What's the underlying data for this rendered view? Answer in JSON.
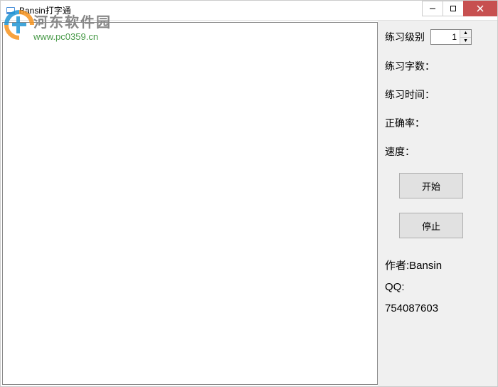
{
  "window": {
    "title": "Bansin打字通"
  },
  "watermark": {
    "title": "河东软件园",
    "url": "www.pc0359.cn"
  },
  "sidebar": {
    "level_label": "练习级别",
    "level_value": "1",
    "char_count_label": "练习字数：",
    "time_label": "练习时间：",
    "accuracy_label": "正确率：",
    "speed_label": "速度：",
    "start_label": "开始",
    "stop_label": "停止",
    "author_label": "作者:Bansin",
    "qq_label": "QQ:",
    "qq_value": "754087603"
  }
}
